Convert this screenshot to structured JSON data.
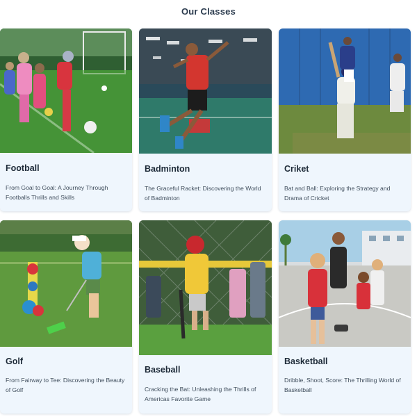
{
  "section": {
    "heading": "Our Classes"
  },
  "cards": [
    {
      "title": "Football",
      "description": "From Goal to Goal: A Journey Through Footballs Thrills and Skills",
      "image": "kids-playing-football-photo"
    },
    {
      "title": "Badminton",
      "description": "The Graceful Racket: Discovering the World of Badminton",
      "image": "boy-jumping-badminton-photo"
    },
    {
      "title": "Criket",
      "description": "Bat and Ball: Exploring the Strategy and Drama of Cricket",
      "image": "boy-batting-cricket-photo"
    },
    {
      "title": "Golf",
      "description": "From Fairway to Tee: Discovering the Beauty of Golf",
      "image": "boy-putting-golf-photo"
    },
    {
      "title": "Baseball",
      "description": "Cracking the Bat: Unleashing the Thrills of Americas Favorite Game",
      "image": "boy-batting-baseball-photo"
    },
    {
      "title": "Basketball",
      "description": "Dribble, Shoot, Score: The Thrilling World of Basketball",
      "image": "kids-basketball-court-photo"
    }
  ]
}
